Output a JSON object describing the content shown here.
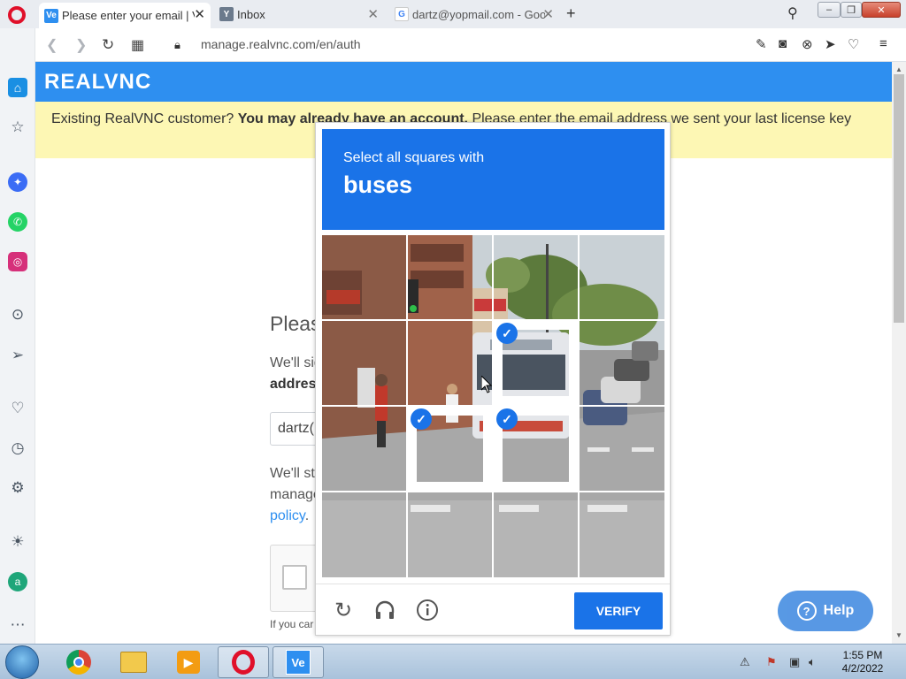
{
  "browser": {
    "tabs": [
      {
        "title": "Please enter your email | V",
        "favicon": "Ve",
        "fav_color": "#2e8ff0",
        "active": true
      },
      {
        "title": "Inbox",
        "favicon": "Y",
        "fav_color": "#6b7a8c",
        "active": false
      },
      {
        "title": "dartz@yopmail.com - Goo",
        "favicon": "G",
        "fav_color": "#4285f4",
        "active": false
      }
    ],
    "url": "manage.realvnc.com/en/auth"
  },
  "page": {
    "brand": "REALVNC",
    "notice_lead": "Existing RealVNC customer? ",
    "notice_bold": "You may already have an account.",
    "notice_rest": " Please enter the email address we sent your last license key",
    "heading_partial": "Pleas",
    "text_1": "We'll sig",
    "text_2": "addres",
    "email_partial": "dartz(",
    "text_3": "We'll ste",
    "text_4": "manage",
    "policy_link": "policy",
    "policy_dot": ".",
    "cant_text": "If you car",
    "help_label": "Help"
  },
  "captcha": {
    "prompt": "Select all squares with",
    "target": "buses",
    "verify_label": "VERIFY",
    "selected_tiles": [
      [
        1,
        2
      ],
      [
        2,
        1
      ],
      [
        2,
        2
      ]
    ]
  },
  "taskbar": {
    "time": "1:55 PM",
    "date": "4/2/2022"
  }
}
